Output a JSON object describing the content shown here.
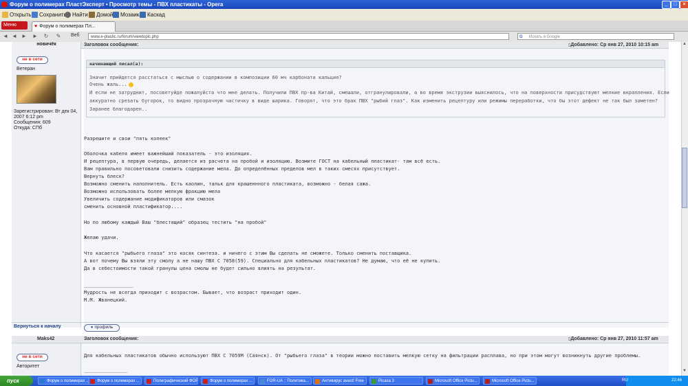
{
  "window": {
    "title": "Форум о полимерах ПластЭксперт • Просмотр темы - ПВХ пластикаты - Opera"
  },
  "toolbar": {
    "open": "Открыть",
    "save": "Сохранить",
    "find": "Найти",
    "home": "Домой",
    "mosaic": "Мозаика",
    "cascade": "Каскад"
  },
  "tabs": {
    "menu": "Меню",
    "active_tab": "Форум о полимерах Пл..."
  },
  "address": {
    "web_label": "Веб",
    "url": "www.e-plastic.ru/forum/viewtopic.php",
    "search_placeholder": "Искать в Google"
  },
  "post1": {
    "top_username": "новичёк",
    "status_badge": "не в сети",
    "rank": "Ветеран",
    "registered": "Зарегистрирован: Вт дек 04, 2007 6:12 pm",
    "messages": "Сообщения: 609",
    "from": "Откуда: СПб",
    "subject_label": "Заголовок сообщения:",
    "posted": "Добавлено: Ср янв 27, 2010 10:15 am",
    "quote_author": "начинающий писал(а):",
    "quote_lines": [
      "Значит прийдется расстаться с мыслью о содержании в композиции 60 мч карбоната кальция?",
      "Очень жаль...",
      "И если не затруднит, посоветуйде пожалуйста что мне делать. Получили ПВХ пр-ва Китай, смешали, отгранулировали, а во время экструзии выяснилось, что на поверхности присудствуют мелкие вкрапления. Если",
      "аккуратно срезать бугорок, то видно прозрачную частичку в виде шарика. Говорят, что это брак ПВХ \"рыбий глаз\". Как изменить рецептуру или режимы переработки, что бы этот дефект не так был заметен?",
      "Заранее благодарен.."
    ],
    "body_lines": [
      "Разрешите и свои \"пять копеек\"",
      "",
      "Оболочка кабеля имеет важнейший показатель - это изоляция.",
      "И рецептура, в первую очередь, делается из расчета на пробой и изоляцию. Возмите ГОСТ на кабельный пластикат- там всё есть.",
      "Вам правильно посоветовали снизить содержание мела. До определённых пределов мел в таких смесях присутствует.",
      "Вернуть блеск?",
      "Возможно сменить наполнитель. Есть каолин, тальк для крашеннного пластиката, возможно - белая сажа.",
      "Возможно использовать более мелкую фракцию мела",
      "Увеличить содержание модификаторов или смазок",
      "сменить основной пластификатор....",
      "",
      "Но по любому каждый Ваш \"блестящий\" образец тестить \"на пробой\"",
      "",
      "Желаю удачи.",
      "",
      "Что касается \"рыбьего глаза\" это косяк синтеза. и ничего с этим Вы сделать не сможете. Только сменить поставщика.",
      "А вот почему Вы взяли эту смолу а не нашу ПВХ С 7058(59). Специально для кабельных пластикатов? Не думаю, что её не купить.",
      "Да в себестоимости такой гранулы цена смолы не будет сильно влиять на результат.",
      "",
      "",
      "_________________",
      "Мудрость не всегда приходит с возрастом. Бывает, что возраст приходит один.",
      "М.М. Жванецкий."
    ],
    "back_to_top": "Вернуться к началу",
    "profile_button": "профиль"
  },
  "post2": {
    "username": "Maks42",
    "status_badge": "не в сети",
    "rank": "Авторитет",
    "subject_label": "Заголовок сообщения:",
    "posted": "Добавлено: Ср янв 27, 2010 11:57 am",
    "body": "Для кабельных пластикатов обычно используют ПВХ С 7059М (Саянск). От \"рыбьего глаза\" в теории можно поставить мелкую сетку на фильтрации расплава, но при этом могут возникнуть другие проблемы.",
    "signature_rule": "_______________"
  },
  "taskbar": {
    "start": "пуск",
    "tasks": [
      "Форум о полимерах ...",
      "Форум о полимерах ...",
      "Полиграфический ФОРУМ :...",
      "Форум о полимерах ...",
      "FOR-UA :: Политика...",
      "Антивирус avast! Free",
      "Picasa 3",
      "Microsoft Office Pictu...",
      "Microsoft Office Pictu..."
    ],
    "lang": "RU",
    "clock": "22:46"
  }
}
